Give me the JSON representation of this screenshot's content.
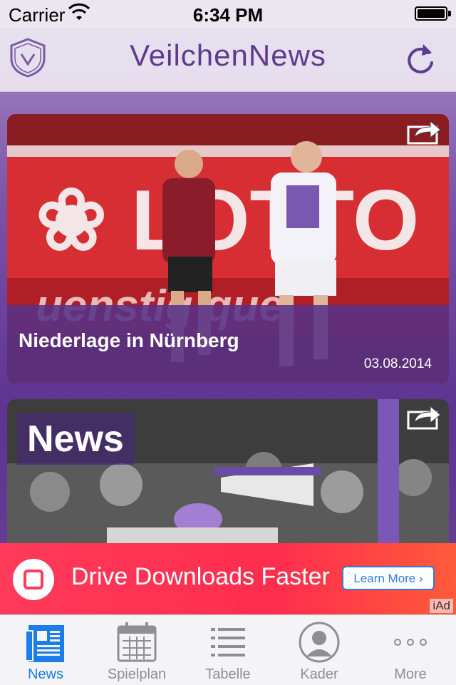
{
  "status_bar": {
    "carrier": "Carrier",
    "time": "6:34 PM"
  },
  "nav": {
    "title": "VeilchenNews"
  },
  "articles": [
    {
      "headline": "Niederlage in Nürnberg",
      "date": "03.08.2014"
    },
    {
      "stamp": "News"
    }
  ],
  "ad": {
    "text": "Drive Downloads Faster",
    "button": "Learn More",
    "label": "iAd",
    "color": "#ff3a5a"
  },
  "tabs": [
    {
      "label": "News",
      "icon": "newspaper-icon",
      "active": true
    },
    {
      "label": "Spielplan",
      "icon": "calendar-icon",
      "active": false
    },
    {
      "label": "Tabelle",
      "icon": "list-icon",
      "active": false
    },
    {
      "label": "Kader",
      "icon": "person-icon",
      "active": false
    },
    {
      "label": "More",
      "icon": "more-icon",
      "active": false
    }
  ],
  "colors": {
    "accent": "#5f3b8e",
    "tab_active": "#1a7de8"
  }
}
